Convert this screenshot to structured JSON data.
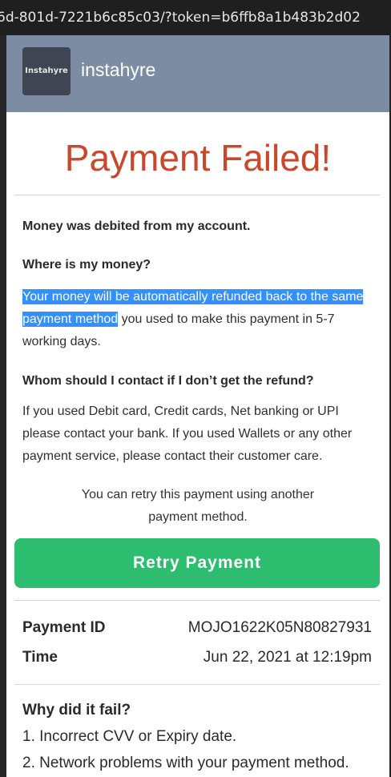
{
  "browser": {
    "url_fragment": "6d-801d-7221b6c85c03/?token=b6ffb8a1b483b2d02"
  },
  "header": {
    "logo_text": "Instahyre",
    "brand": "instahyre"
  },
  "status": {
    "title": "Payment Failed!"
  },
  "info": {
    "debited": "Money was debited from my account.",
    "where_q": "Where is my money?",
    "refund_highlight_1": "Your money will be automatically refunded back to the same",
    "refund_highlight_2": "payment method",
    "refund_rest_1": " you used to make this payment in 5-7",
    "refund_rest_2": "working days.",
    "contact_q": "Whom should I contact if I don’t get the refund?",
    "contact_1": "If you used Debit card, Credit cards, Net banking or UPI",
    "contact_2": "please contact your bank. If you used Wallets or any other",
    "contact_3": "payment service, please contact their customer care."
  },
  "retry": {
    "note_1": "You can retry this payment using another",
    "note_2": "payment method.",
    "button_label": "Retry Payment"
  },
  "details": {
    "payment_id_label": "Payment ID",
    "payment_id_value": "MOJO1622K05N80827931",
    "time_label": "Time",
    "time_value": "Jun 22, 2021 at 12:19pm"
  },
  "reasons": {
    "heading": "Why did it fail?",
    "items": [
      "1. Incorrect CVV or Expiry date.",
      "2. Network problems with your payment method."
    ]
  },
  "colors": {
    "header_bg": "#7b8ca3",
    "title": "#c9482c",
    "retry_button": "#2dbd6e",
    "selection": "#3390ff"
  }
}
